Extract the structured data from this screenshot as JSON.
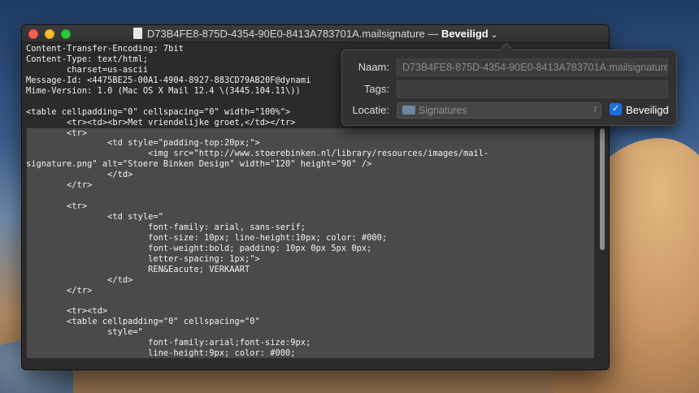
{
  "window": {
    "title_name": "D73B4FE8-875D-4354-90E0-8413A783701A.mailsignature",
    "title_sep": " — ",
    "title_status": "Beveiligd",
    "title_chevron": "⌄"
  },
  "code_lines": [
    "Content-Transfer-Encoding: 7bit",
    "Content-Type: text/html;",
    "        charset=us-ascii",
    "Message-Id: <4475BE25-00A1-4904-8927-883CD79AB20F@dynami",
    "Mime-Version: 1.0 (Mac OS X Mail 12.4 \\(3445.104.11\\))",
    "",
    "<table cellpadding=\"0\" cellspacing=\"0\" width=\"100%\">",
    "        <tr><td><br>Met vriendelijke groet,</td></tr>",
    "        <tr>",
    "                <td style=\"padding-top:20px;\">",
    "                        <img src=\"http://www.stoerebinken.nl/library/resources/images/mail-",
    "signature.png\" alt=\"Stoere Binken Design\" width=\"120\" height=\"90\" />",
    "                </td>",
    "        </tr>",
    "",
    "        <tr>",
    "                <td style=\"",
    "                        font-family: arial, sans-serif;",
    "                        font-size: 10px; line-height:10px; color: #000;",
    "                        font-weight:bold; padding: 10px 0px 5px 0px;",
    "                        letter-spacing: 1px;\">",
    "                        REN&Eacute; VERKAART",
    "                </td>",
    "        </tr>",
    "",
    "        <tr><td>",
    "        <table cellpadding=\"0\" cellspacing=\"0\"",
    "                style=\"",
    "                        font-family:arial;font-size:9px;",
    "                        line-height:9px; color: #000;"
  ],
  "popover": {
    "name_label": "Naam:",
    "name_value": "D73B4FE8-875D-4354-90E0-8413A783701A.mailsignature",
    "tags_label": "Tags:",
    "tags_value": "",
    "location_label": "Locatie:",
    "location_value": "Signatures",
    "locked_label": "Beveiligd",
    "locked_checked": true
  }
}
